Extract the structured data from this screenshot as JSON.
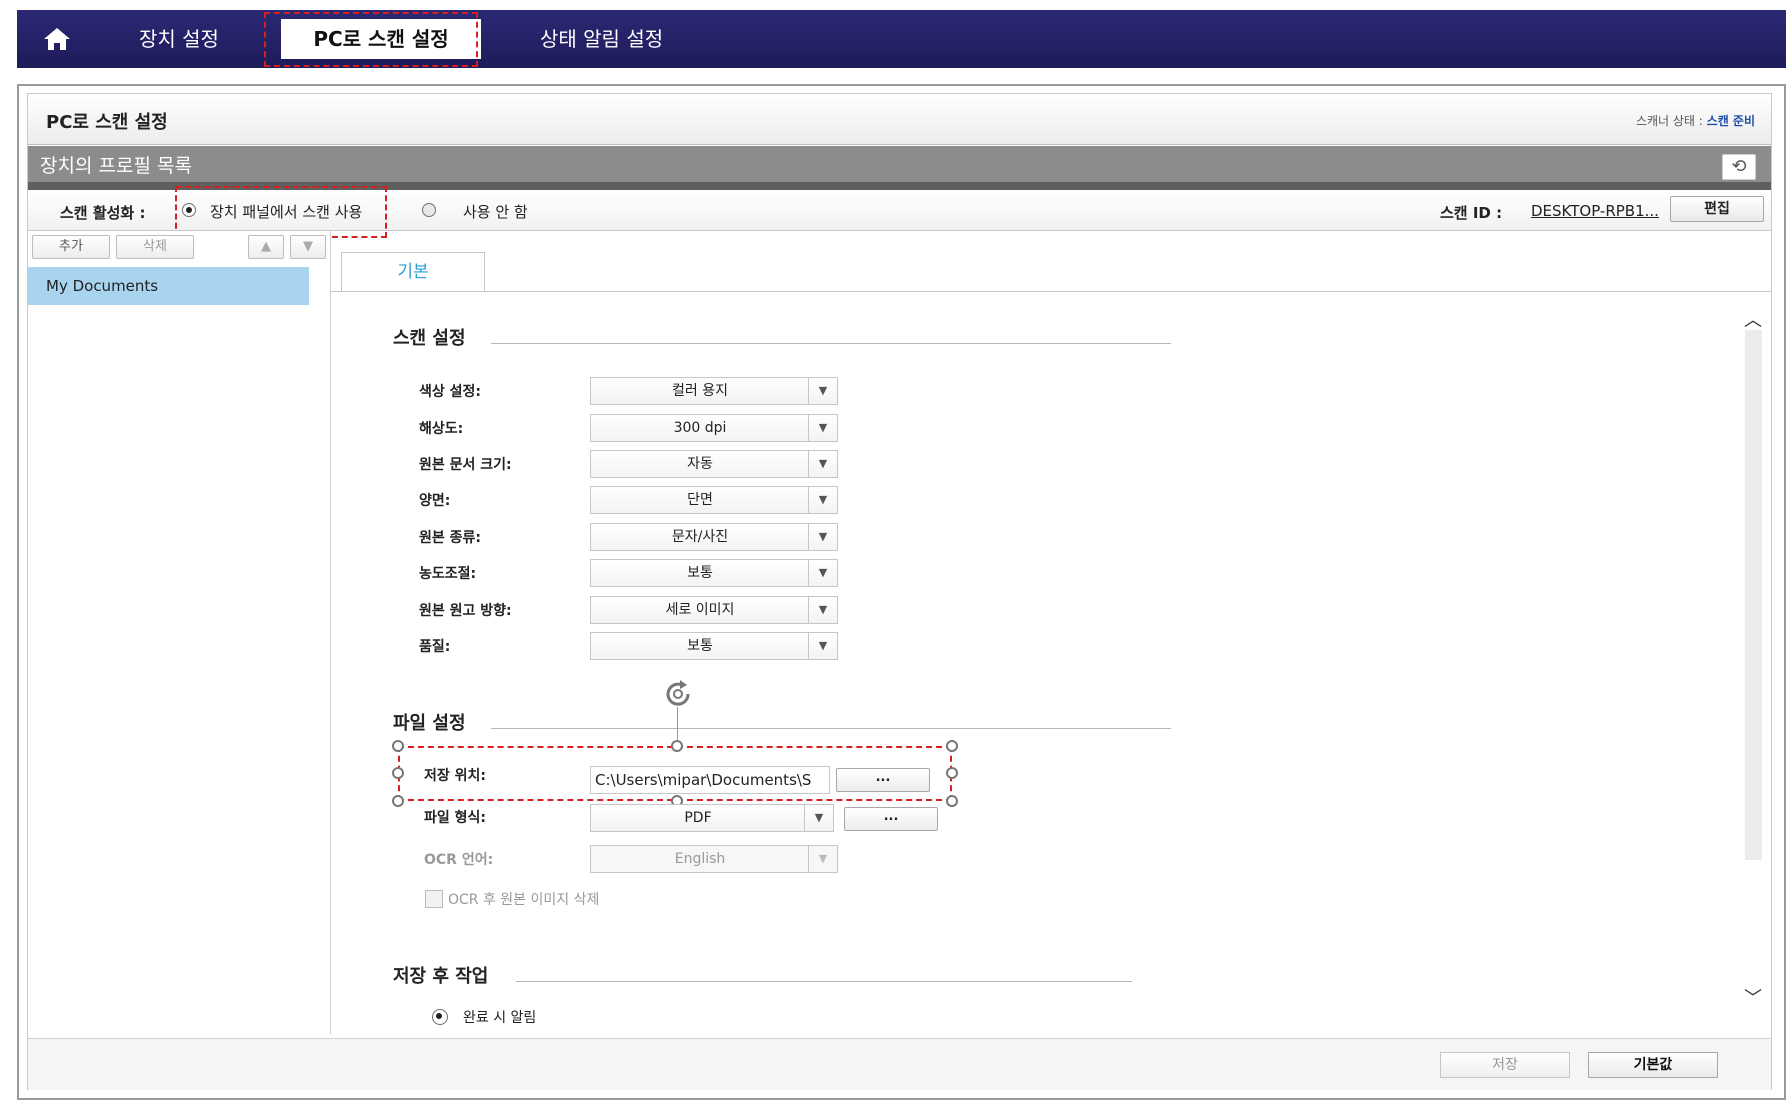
{
  "nav": {
    "tabs": [
      "장치 설정",
      "PC로 스캔 설정",
      "상태 알림 설정"
    ]
  },
  "header": {
    "title": "PC로 스캔 설정",
    "scanner_status_label": "스캐너 상태 :",
    "scanner_status_value": "스캔 준비"
  },
  "profile_list": {
    "title": "장치의 프로필 목록",
    "add_label": "추가",
    "delete_label": "삭제",
    "items": [
      "My Documents"
    ]
  },
  "scan_enable": {
    "label": "스캔 활성화 :",
    "option_panel": "장치 패널에서 스캔 사용",
    "option_off": "사용 안 함",
    "selected": "장치 패널에서 스캔 사용",
    "scan_id_label": "스캔 ID :",
    "scan_id_value": "DESKTOP-RPB1...",
    "edit_label": "편집"
  },
  "tabs": [
    "기본"
  ],
  "scan_settings": {
    "title": "스캔 설정",
    "fields": [
      {
        "label": "색상 설정:",
        "value": "컬러 용지"
      },
      {
        "label": "해상도:",
        "value": "300 dpi"
      },
      {
        "label": "원본 문서 크기:",
        "value": "자동"
      },
      {
        "label": "양면:",
        "value": "단면"
      },
      {
        "label": "원본 종류:",
        "value": "문자/사진"
      },
      {
        "label": "농도조절:",
        "value": "보통"
      },
      {
        "label": "원본 원고 방향:",
        "value": "세로 이미지"
      },
      {
        "label": "품질:",
        "value": "보통"
      }
    ]
  },
  "file_settings": {
    "title": "파일 설정",
    "save_location_label": "저장 위치:",
    "save_location_value": "C:\\Users\\mipar\\Documents\\S",
    "browse_label": "...",
    "file_format_label": "파일 형식:",
    "file_format_value": "PDF",
    "ocr_language_label": "OCR 언어:",
    "ocr_language_value": "English",
    "ocr_delete_label": "OCR 후 원본 이미지 삭제"
  },
  "after_save": {
    "title": "저장 후 작업",
    "option_notify": "완료 시 알림"
  },
  "footer": {
    "save_label": "저장",
    "default_label": "기본값"
  },
  "colors": {
    "nav_bg": "#2c2975",
    "highlight": "#d62020",
    "tab_active_text": "#2a9fd6",
    "list_selected": "#a8d4ef"
  }
}
